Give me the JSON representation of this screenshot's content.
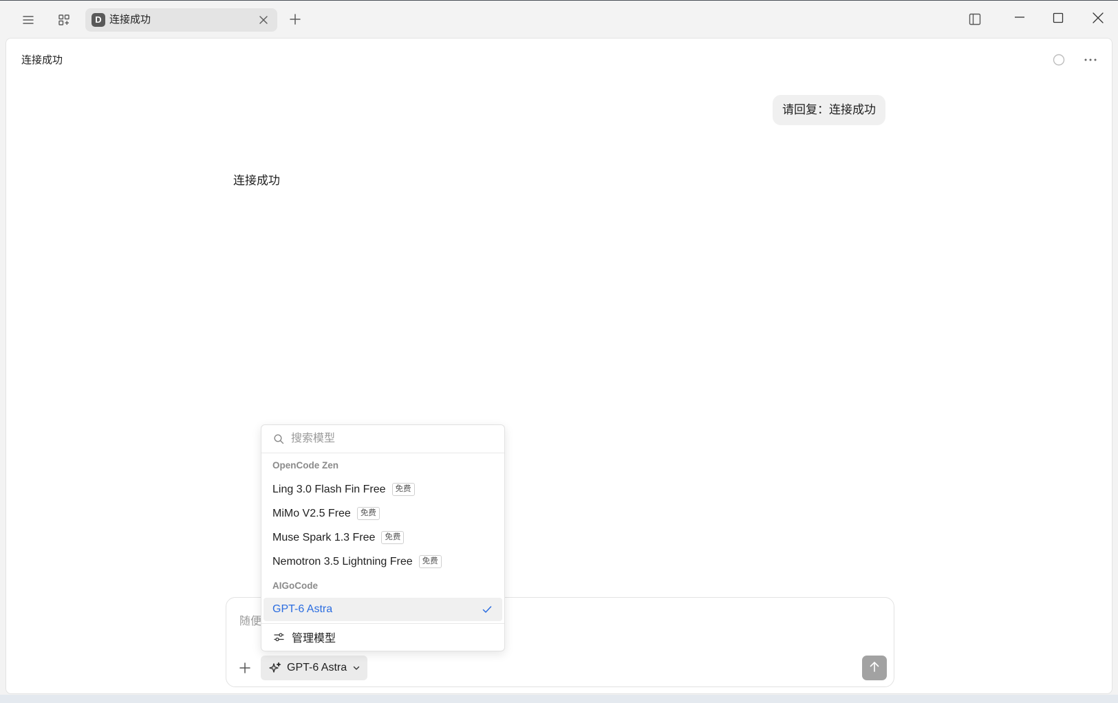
{
  "tab": {
    "badge": "D",
    "title": "连接成功"
  },
  "header": {
    "title": "连接成功"
  },
  "messages": [
    {
      "role": "user",
      "text": "请回复：连接成功"
    },
    {
      "role": "assistant",
      "text": "连接成功"
    }
  ],
  "composer": {
    "placeholder": "随便",
    "model_label": "GPT-6 Astra"
  },
  "model_menu": {
    "search_placeholder": "搜索模型",
    "groups": [
      {
        "name": "OpenCode Zen",
        "models": [
          {
            "name": "Ling 3.0 Flash Fin Free",
            "badge": "免费"
          },
          {
            "name": "MiMo V2.5 Free",
            "badge": "免费"
          },
          {
            "name": "Muse Spark 1.3 Free",
            "badge": "免费"
          },
          {
            "name": "Nemotron 3.5 Lightning Free",
            "badge": "免费"
          }
        ]
      },
      {
        "name": "AIGoCode",
        "models": [
          {
            "name": "GPT-6 Astra",
            "selected": true
          }
        ]
      }
    ],
    "manage_label": "管理模型"
  },
  "colors": {
    "accent": "#2b6de0",
    "tab_background": "#e4e4e4",
    "send_button": "#a2a2a2",
    "selected_row": "#f0f0f0"
  },
  "icons": {
    "titlebar": [
      "hamburger-icon",
      "grid-icon",
      "close-icon",
      "plus-icon",
      "sidebar-toggle-icon",
      "minimize-icon",
      "maximize-icon",
      "close-icon"
    ],
    "header": [
      "circle-status-icon",
      "more-dots-icon"
    ],
    "composer": [
      "plus-icon",
      "sparkle-icon",
      "chevron-down-icon",
      "arrow-up-icon"
    ],
    "menu": [
      "search-icon",
      "check-icon",
      "sliders-icon"
    ]
  }
}
